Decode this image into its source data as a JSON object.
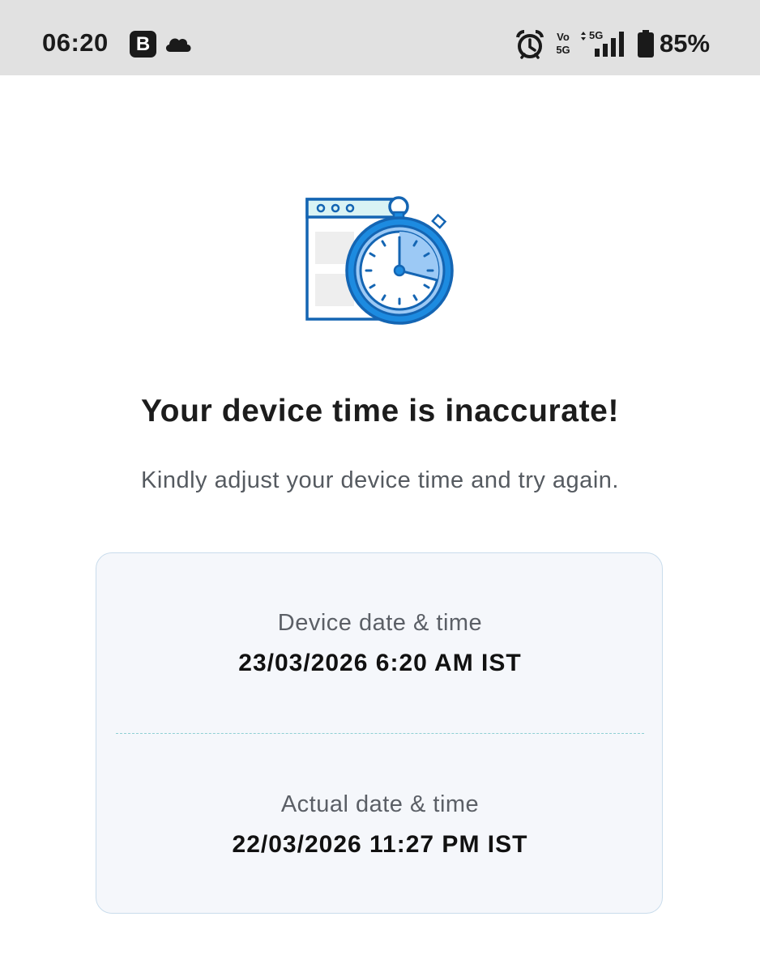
{
  "status_bar": {
    "time": "06:20",
    "app_badge": "B",
    "volte_top": "Vo",
    "volte_bottom": "5G",
    "network_type": "5G",
    "battery": "85%",
    "icons": [
      "b-app-icon",
      "cloud-icon",
      "alarm-icon",
      "volte-icon",
      "signal-icon",
      "battery-icon"
    ]
  },
  "illustration": {
    "name": "browser-stopwatch-illustration",
    "colors": {
      "primary_blue": "#1d8be0",
      "dark_blue": "#1465b3",
      "light_blue": "#9cc9f5",
      "pale_cyan": "#d9f3f4",
      "panel_gray": "#eeeeee"
    }
  },
  "message": {
    "title": "Your device time is inaccurate!",
    "subtitle": "Kindly adjust your device time and try again."
  },
  "time_card": {
    "device_label": "Device date & time",
    "device_value": "23/03/2026 6:20 AM IST",
    "actual_label": "Actual date & time",
    "actual_value": "22/03/2026 11:27 PM IST"
  }
}
